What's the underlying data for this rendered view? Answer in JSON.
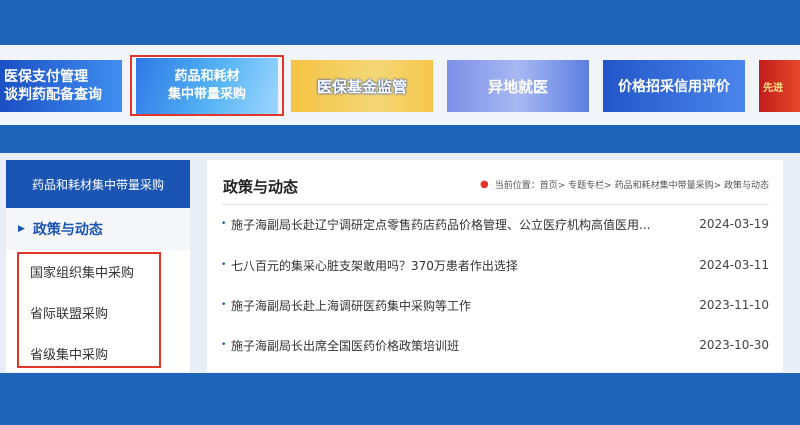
{
  "banners": [
    {
      "lines": [
        "医保支付管理",
        "谈判药配备查询"
      ]
    },
    {
      "lines": [
        "药品和耗材",
        "集中带量采购"
      ]
    },
    {
      "lines": [
        "医保基金监管"
      ]
    },
    {
      "lines": [
        "异地就医"
      ]
    },
    {
      "lines": [
        "价格招采信用评价"
      ]
    },
    {
      "lines": [
        "先进"
      ]
    }
  ],
  "sidebar": {
    "header": "药品和耗材集中带量采购",
    "active": "政策与动态",
    "items": [
      "国家组织集中采购",
      "省际联盟采购",
      "省级集中采购"
    ]
  },
  "panel": {
    "title": "政策与动态",
    "breadcrumb": "当前位置：首页> 专题专栏> 药品和耗材集中带量采购> 政策与动态",
    "news": [
      {
        "title": "施子海副局长赴辽宁调研定点零售药店药品价格管理、公立医疗机构高值医用...",
        "date": "2024-03-19"
      },
      {
        "title": "七八百元的集采心脏支架敢用吗？370万患者作出选择",
        "date": "2024-03-11"
      },
      {
        "title": "施子海副局长赴上海调研医药集中采购等工作",
        "date": "2023-11-10"
      },
      {
        "title": "施子海副局长出席全国医药价格政策培训班",
        "date": "2023-10-30"
      }
    ]
  }
}
